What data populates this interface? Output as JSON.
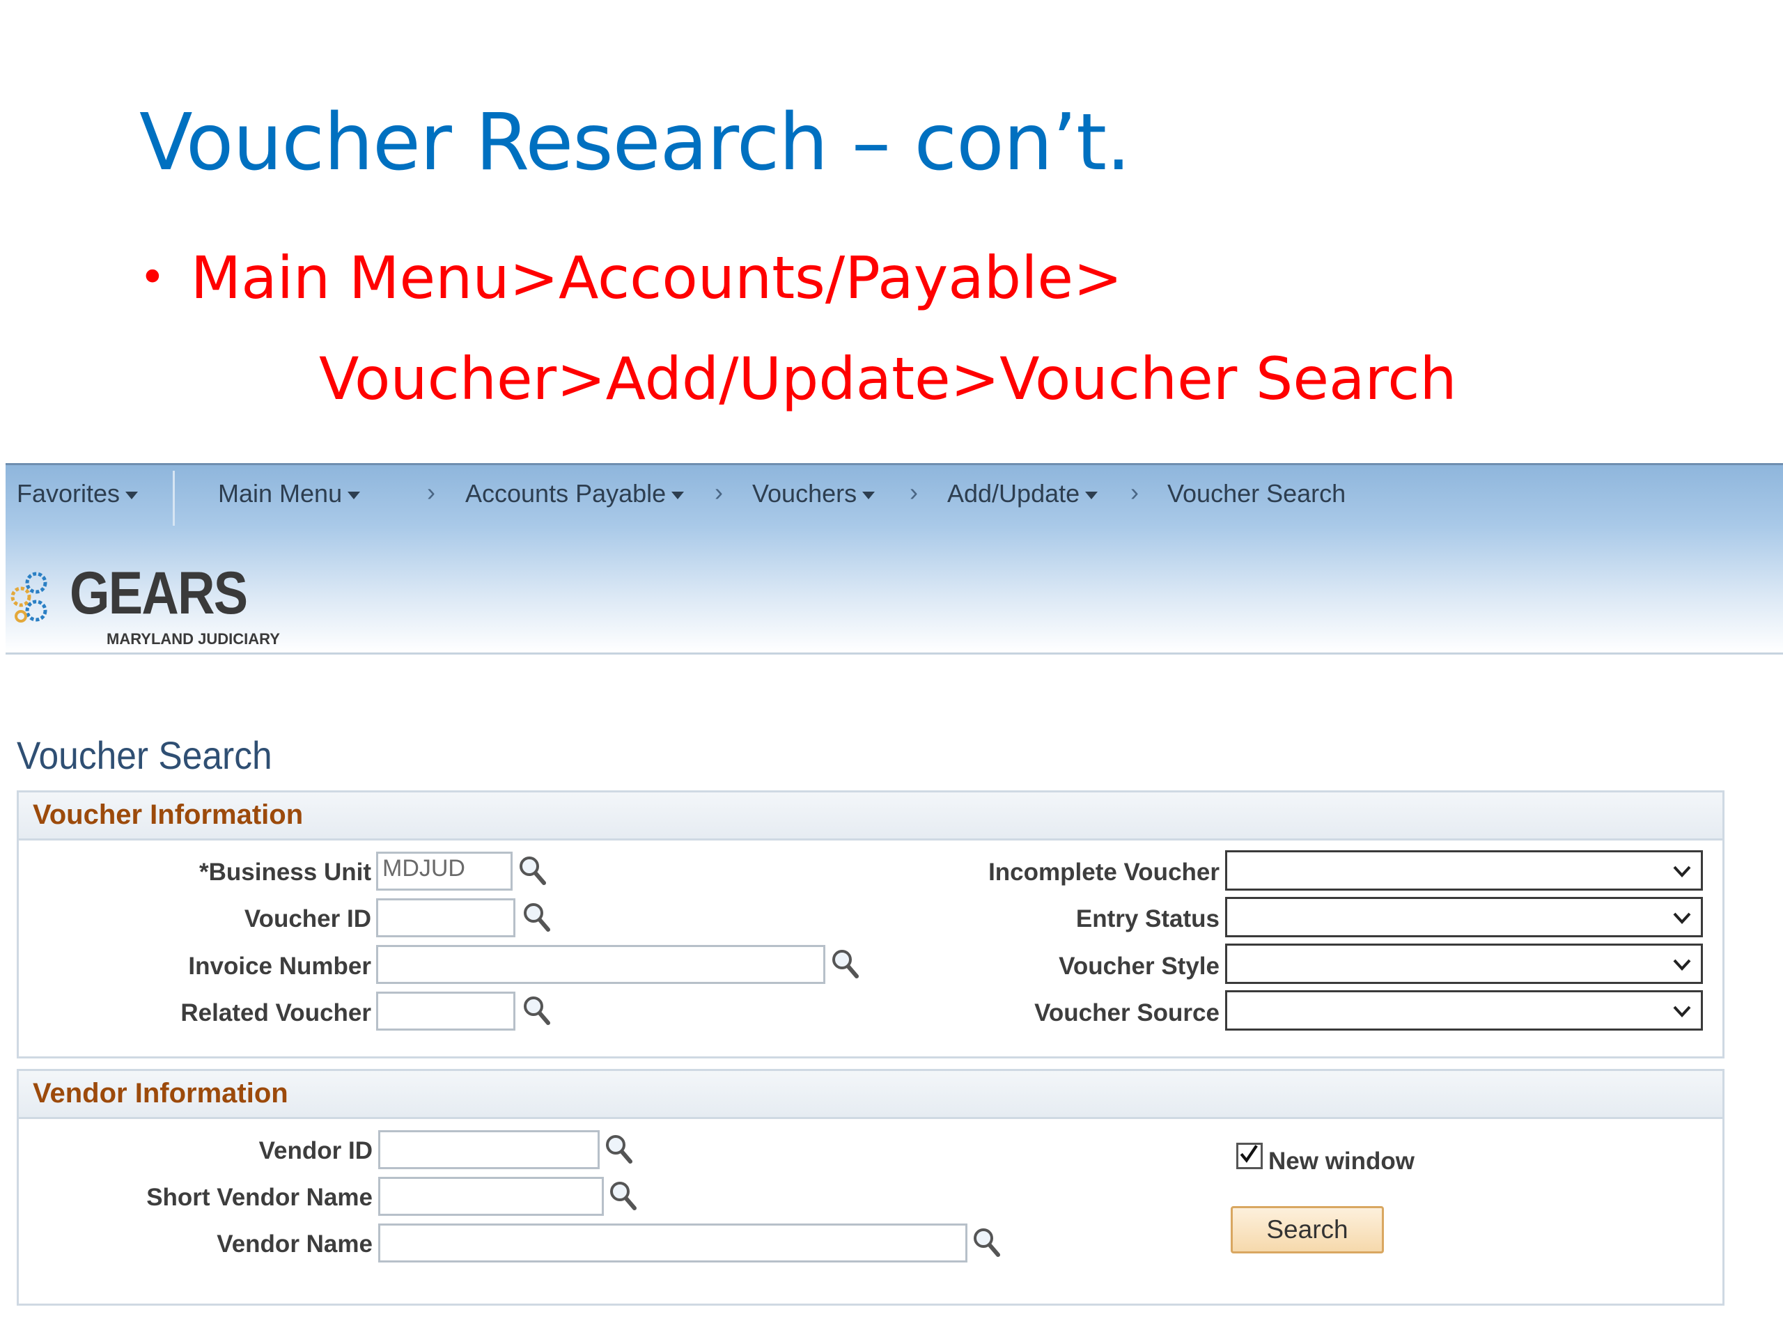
{
  "slide": {
    "title": "Voucher  Research – con’t.",
    "bullet_line1": "Main Menu>Accounts/Payable>",
    "bullet_line2": "Voucher>Add/Update>Voucher Search",
    "bullet_char": "•"
  },
  "navbar": {
    "favorites": "Favorites",
    "main_menu": "Main Menu",
    "accounts_payable": "Accounts Payable",
    "vouchers": "Vouchers",
    "add_update": "Add/Update",
    "current": "Voucher Search",
    "separator": ">"
  },
  "banner": {
    "logo_name": "GEARS",
    "logo_subtitle": "MARYLAND JUDICIARY",
    "logo_icon": "gears-icon"
  },
  "page": {
    "title": "Voucher Search"
  },
  "voucher_info": {
    "title": "Voucher Information",
    "business_unit_label": "*Business Unit",
    "business_unit_value": "MDJUD",
    "voucher_id_label": "Voucher ID",
    "voucher_id_value": "",
    "invoice_number_label": "Invoice Number",
    "invoice_number_value": "",
    "related_voucher_label": "Related Voucher",
    "related_voucher_value": "",
    "incomplete_voucher_label": "Incomplete Voucher",
    "incomplete_voucher_value": "",
    "entry_status_label": "Entry Status",
    "entry_status_value": "",
    "voucher_style_label": "Voucher Style",
    "voucher_style_value": "",
    "voucher_source_label": "Voucher Source",
    "voucher_source_value": ""
  },
  "vendor_info": {
    "title": "Vendor Information",
    "vendor_id_label": "Vendor ID",
    "vendor_id_value": "",
    "short_vendor_name_label": "Short Vendor Name",
    "short_vendor_name_value": "",
    "vendor_name_label": "Vendor Name",
    "vendor_name_value": "",
    "new_window_label": "New window",
    "new_window_checked": true,
    "search_button": "Search"
  },
  "colors": {
    "slide_title": "#0070c0",
    "bullet": "#ff0000",
    "group_title": "#9c4a0b",
    "navbar": "#a9c9e8",
    "button": "#f6d9ac"
  }
}
